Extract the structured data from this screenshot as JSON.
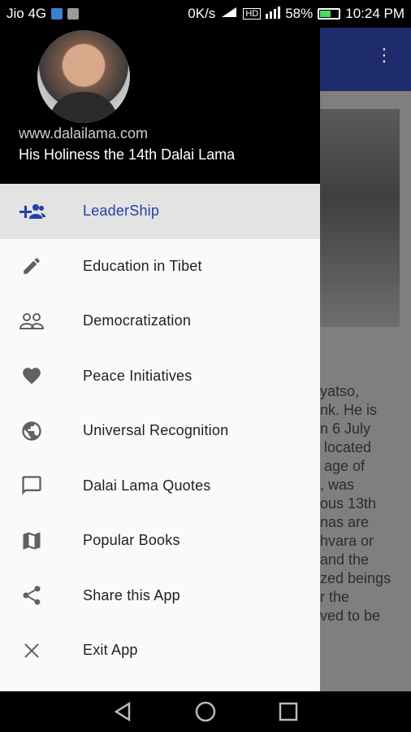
{
  "status_bar": {
    "carrier": "Jio 4G",
    "speed": "0K/s",
    "hd": "HD",
    "battery_pct": "58%",
    "time": "10:24 PM"
  },
  "drawer": {
    "header": {
      "url": "www.dalailama.com",
      "title": "His Holiness the 14th Dalai Lama"
    },
    "items": [
      {
        "label": "LeaderShip",
        "icon": "add-group-icon",
        "active": true
      },
      {
        "label": "Education in Tibet",
        "icon": "pencil-icon",
        "active": false
      },
      {
        "label": "Democratization",
        "icon": "people-icon",
        "active": false
      },
      {
        "label": "Peace Initiatives",
        "icon": "heart-icon",
        "active": false
      },
      {
        "label": "Universal Recognition",
        "icon": "globe-icon",
        "active": false
      },
      {
        "label": "Dalai Lama Quotes",
        "icon": "comment-icon",
        "active": false
      },
      {
        "label": "Popular Books",
        "icon": "map-icon",
        "active": false
      },
      {
        "label": "Share this App",
        "icon": "share-icon",
        "active": false
      },
      {
        "label": "Exit App",
        "icon": "close-icon",
        "active": false
      }
    ]
  },
  "background_content": {
    "text_fragment": "yatso,\nnk. He is\nn 6 July\n located\n age of\n, was\nous 13th\nnas are\nhvara or\nand the\nzed beings\nr the\nved to be"
  },
  "colors": {
    "accent": "#2540a8",
    "toolbar": "#1f2c6b",
    "active_row": "#e3e3e3"
  }
}
